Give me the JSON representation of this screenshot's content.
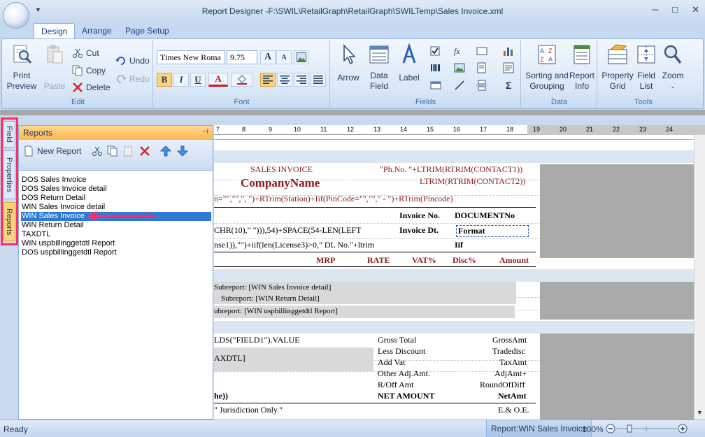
{
  "window": {
    "title": "Report Designer -F:\\SWIL\\RetailGraph\\RetailGraph\\SWILTemp\\Sales Invoice.xml",
    "qat_glyph": "▼",
    "minimize": "─",
    "maximize": "□",
    "close": "✕"
  },
  "tabs": [
    {
      "label": "Design"
    },
    {
      "label": "Arrange"
    },
    {
      "label": "Page Setup"
    }
  ],
  "ribbon": {
    "edit": {
      "label": "Edit",
      "print_preview": [
        "Print",
        "Preview"
      ],
      "paste": "Paste",
      "cut": "Cut",
      "copy": "Copy",
      "delete": "Delete"
    },
    "undo": {
      "undo": "Undo",
      "redo": "Redo"
    },
    "font": {
      "label": "Font",
      "font_name": "Times New Roma",
      "font_size": "9.75",
      "bold": "B",
      "italic": "I",
      "underline": "U",
      "grow": "A",
      "shrink": "A",
      "font_color": "A"
    },
    "fields": {
      "label": "Fields",
      "arrow": "Arrow",
      "data_field": [
        "Data",
        "Field"
      ],
      "label_btn": "Label",
      "fx": "fx",
      "sigma": "Σ"
    },
    "data": {
      "label": "Data",
      "sorting": [
        "Sorting and",
        "Grouping"
      ],
      "report_info": [
        "Report",
        "Info"
      ]
    },
    "tools": {
      "label": "Tools",
      "property_grid": [
        "Property",
        "Grid"
      ],
      "field_list": [
        "Field",
        "List"
      ],
      "zoom": "Zoom"
    }
  },
  "sidetabs": [
    {
      "label": "Field"
    },
    {
      "label": "Properties"
    },
    {
      "label": "Reports"
    }
  ],
  "reports_panel": {
    "title": "Reports",
    "new_report": "New Report",
    "items": [
      "DOS Sales Invoice",
      "DOS Sales Invoice detail",
      "DOS Return Detail",
      "WIN Sales Invoice detail",
      "WIN Sales Invoice",
      "WIN Return Detail",
      "TAXDTL",
      "WIN uspbillinggetdtl Report",
      "DOS uspbillinggetdtl Report"
    ],
    "selected_index": 4
  },
  "designer": {
    "ruler": [
      "7",
      "8",
      "9",
      "10",
      "11",
      "12",
      "13",
      "14",
      "15",
      "16",
      "17",
      "18",
      "19",
      "20",
      "21",
      "22",
      "23",
      "24"
    ],
    "lines": {
      "sales_invoice": "SALES INVOICE",
      "ph_no": "\"Ph.No. \"+LTRIM(RTRIM(CONTACT1))",
      "company": "CompanyName",
      "contact2": "LTRIM(RTRIM(CONTACT2))",
      "station": "n=\"\",\"\",\", \")+RTrim(Station)+Iif(PinCode=\"\",\"\",\" - \")+RTrim(Pincode)",
      "invoice_no": "Invoice No.",
      "document_no": "DOCUMENTNo",
      "chr10": "CHR(10),\" \"))),54)+SPACE(54-LEN(LEFT",
      "invoice_dt": "Invoice Dt.",
      "format": "Format",
      "license": "nse1)),\"\")+iif(len(License3)>0,\" DL No.\"+ltrim",
      "iif": "Iif",
      "mrp": "MRP",
      "rate": "RATE",
      "vat": "VAT%",
      "disc": "Disc%",
      "amount": "Amount",
      "sub1": "Subreport: [WIN Sales Invoice detail]",
      "sub2": "Subreport: [WIN Return Detail]",
      "sub3": "ubreport: [WIN uspbillinggetdtl Report]",
      "field1": "LDS(\"FIELD1\").VALUE",
      "axdtl": "AXDTL]",
      "gross_total": "Gross Total",
      "gross_amt": "GrossAmt",
      "less_discount": "Less Discount",
      "tradedisc": "Tradedisc",
      "add_vat": "Add Vat",
      "taxamt": "TaxAmt",
      "other_adj": "Other Adj.Amt.",
      "adjamt": "AdjAmt+",
      "roff_amt": "R/Off Amt",
      "roundoffdiff": "RoundOfDiff",
      "he": "he))",
      "net_amount": "NET AMOUNT",
      "netamt": "NetAmt",
      "jurisdiction": "\" Jurisdiction Only.\"",
      "eoe": "E.& O.E."
    }
  },
  "status": {
    "ready": "Ready",
    "report": "Report:WIN Sales Invoice",
    "zoom": "100%"
  },
  "colors": {
    "accent": "#2f7ad6",
    "annotation": "#ff2d64",
    "title_red": "#8b1c1c"
  }
}
